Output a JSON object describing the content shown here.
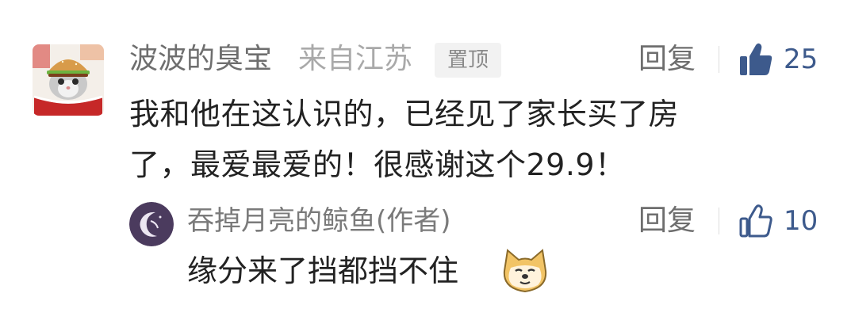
{
  "comment": {
    "username": "波波的臭宝",
    "location": "来自江苏",
    "pinned_label": "置顶",
    "reply_label": "回复",
    "like_count": "25",
    "text_lines": [
      "我和他在这认识的，已经见了家长买了房",
      "了，最爱最爱的！很感谢这个29.9！"
    ]
  },
  "reply": {
    "username": "吞掉月亮的鲸鱼(作者)",
    "reply_label": "回复",
    "like_count": "10",
    "text": "缘分来了挡都挡不住",
    "emoji_icon": "doge-emoji-icon"
  },
  "colors": {
    "accent_blue": "#3d5a8c",
    "avatar_reply_bg": "#4b3b5e"
  }
}
